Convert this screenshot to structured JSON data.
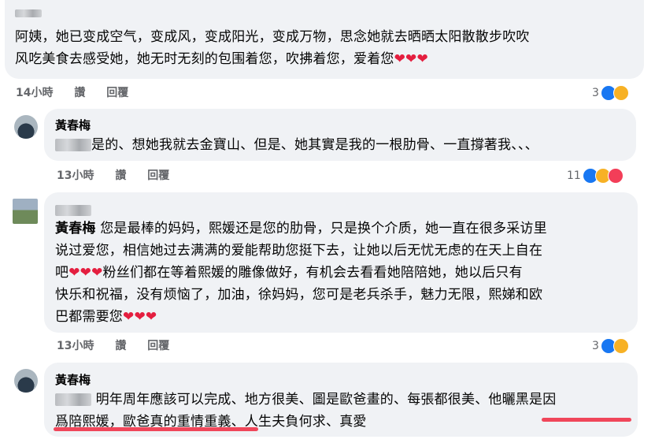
{
  "comments": [
    {
      "name": "",
      "text_lines": [
        "阿姨，她已变成空气，变成风，变成阳光，变成万物，思念她就去晒晒太阳散散步吹吹",
        "风吃美食去感受她，她无时无刻的包围着您，吹拂着您，爱着您"
      ],
      "time": "14小時",
      "like_label": "讚",
      "reply_label": "回覆",
      "react_count": "3"
    },
    {
      "name": "黃春梅",
      "text_lines": [
        "是的、想她我就去金寶山、但是、她其實是我的一根肋骨、一直撐著我、、、"
      ],
      "time": "13小時",
      "like_label": "讚",
      "reply_label": "回覆",
      "react_count": "11"
    },
    {
      "name": "黃春梅",
      "text_lines": [
        "您是最棒的妈妈，熙媛还是您的肋骨，只是换个介质，她一直在很多采访里",
        "说过爱您，相信她过去满满的爱能帮助您挺下去，让她以后无忧无虑的在天上自在",
        "吧",
        "粉丝们都在等着熙媛的雕像做好，有机会去看看她陪陪她，她以后只有",
        "快乐和祝福，没有烦恼了，加油，徐妈妈，您可是老兵杀手，魅力无限，熙娣和欧",
        "巴都需要您"
      ],
      "time": "13小時",
      "like_label": "讚",
      "reply_label": "回覆",
      "react_count": "3"
    },
    {
      "name": "黃春梅",
      "text_lines": [
        "明年周年應該可以完成、地方很美、圖是歐爸畫的、每張都很美、他曬黑是因",
        "爲陪熙媛，歐爸真的重情重義、人生夫負何求、真愛"
      ]
    }
  ],
  "hearts": "❤❤❤",
  "colors": {
    "like": "#1877f2",
    "care": "#f7b125",
    "love": "#f33e58",
    "underline": "#f0465a"
  }
}
